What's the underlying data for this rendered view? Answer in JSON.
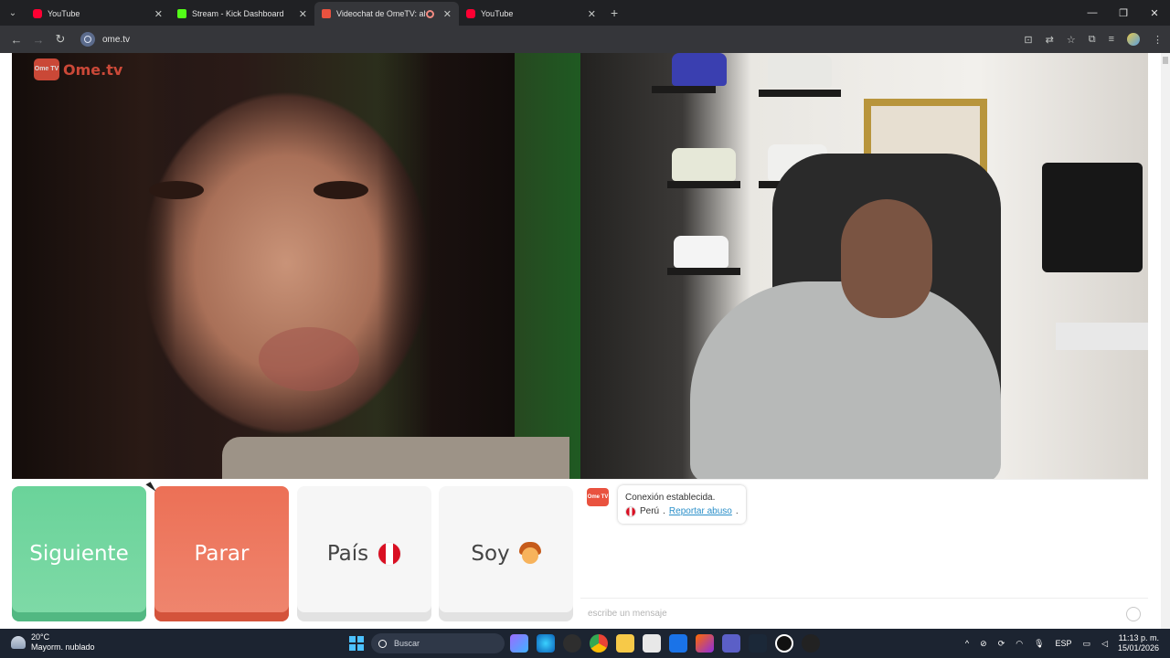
{
  "browser": {
    "tabs": [
      {
        "title": "YouTube",
        "favicon": "youtube-icon"
      },
      {
        "title": "Stream - Kick Dashboard",
        "favicon": "kick-icon"
      },
      {
        "title": "Videochat de OmeTV: altern",
        "favicon": "ometv-icon",
        "active": true
      },
      {
        "title": "YouTube",
        "favicon": "youtube-icon"
      }
    ],
    "new_tab_label": "+",
    "url": "ome.tv",
    "window_controls": [
      "—",
      "❐",
      "✕"
    ]
  },
  "ome": {
    "logo_text": "Ome.tv",
    "logo_badge": "Ome TV",
    "buttons": {
      "next": "Siguiente",
      "stop": "Parar",
      "country": "País",
      "soy": "Soy"
    },
    "chat": {
      "status": "Conexión establecida.",
      "country": "Perú",
      "separator": " . ",
      "report_link": "Reportar abuso",
      "report_suffix": ".",
      "message_placeholder": "escribe un mensaje"
    },
    "colors": {
      "next": "#6ad39a",
      "stop": "#ec7056",
      "brand": "#e9523f",
      "link": "#2a8fc9"
    }
  },
  "taskbar": {
    "weather_temp": "20°C",
    "weather_desc": "Mayorm. nublado",
    "search_placeholder": "Buscar",
    "language": "ESP",
    "time": "11:13 p. m.",
    "date": "15/01/2026"
  }
}
